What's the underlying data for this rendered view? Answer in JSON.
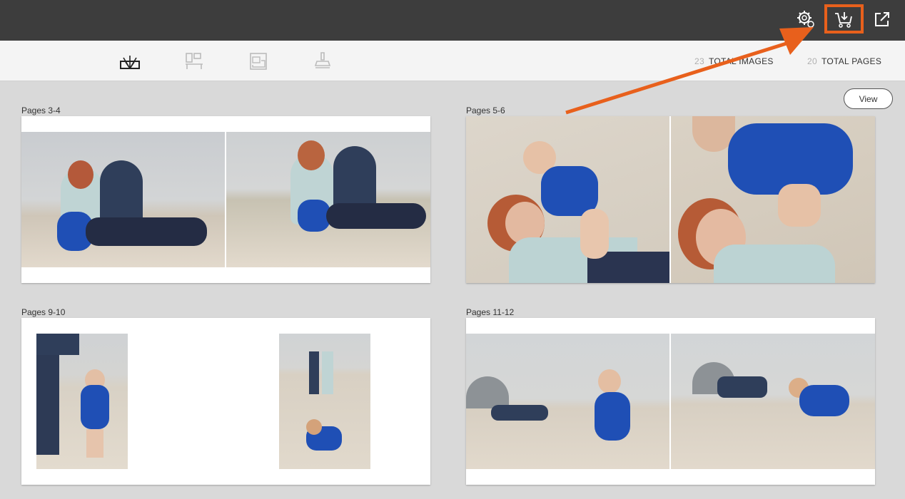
{
  "toolbar": {
    "icons": [
      "settings-icon",
      "cart-download-icon",
      "export-icon"
    ],
    "highlight_color": "#e8601c"
  },
  "subbar": {
    "tools": [
      "book-icon",
      "layout-icon",
      "page-icon",
      "stamp-icon"
    ],
    "images_count": "23",
    "images_label": "TOTAL IMAGES",
    "pages_count": "20",
    "pages_label": "TOTAL PAGES"
  },
  "view_button": "View",
  "spreads": [
    {
      "label": "Pages 3-4"
    },
    {
      "label": "Pages 5-6"
    },
    {
      "label": "Pages 9-10"
    },
    {
      "label": "Pages 11-12"
    }
  ]
}
